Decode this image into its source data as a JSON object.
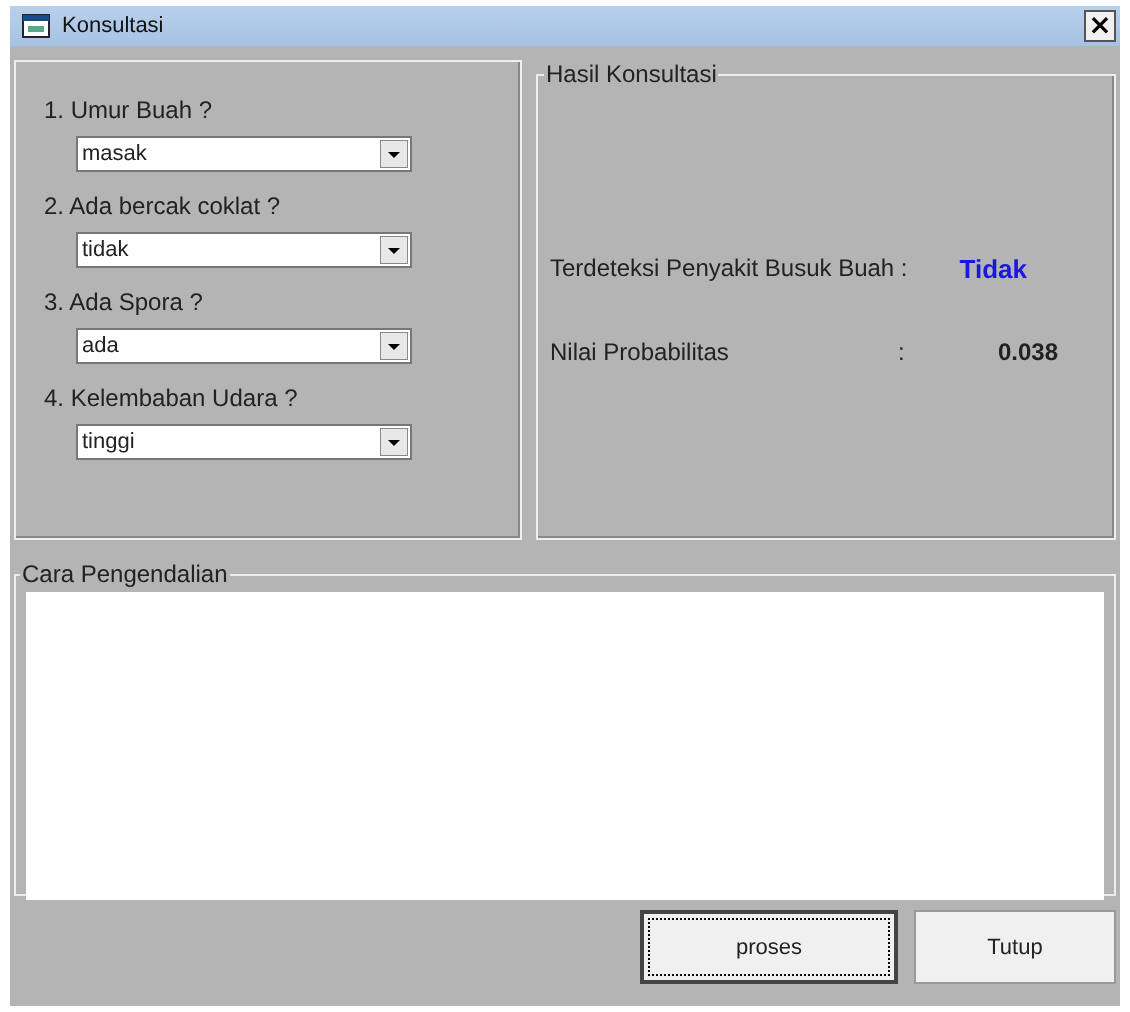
{
  "window": {
    "title": "Konsultasi",
    "close": "×"
  },
  "questions": [
    {
      "label": "1. Umur Buah ?",
      "value": "masak"
    },
    {
      "label": "2. Ada bercak coklat ?",
      "value": "tidak"
    },
    {
      "label": "3. Ada Spora ?",
      "value": "ada"
    },
    {
      "label": "4. Kelembaban Udara ?",
      "value": "tinggi"
    }
  ],
  "result": {
    "title": "Hasil Konsultasi",
    "rows": [
      {
        "label": "Terdeteksi Penyakit Busuk Buah :",
        "value": "Tidak",
        "kind": "status"
      },
      {
        "label": "Nilai Probabilitas",
        "colon": ":",
        "value": "0.038",
        "kind": "number"
      }
    ]
  },
  "control": {
    "title": "Cara Pengendalian"
  },
  "buttons": [
    {
      "label": "proses",
      "focused": true
    },
    {
      "label": "Tutup",
      "focused": false
    }
  ]
}
